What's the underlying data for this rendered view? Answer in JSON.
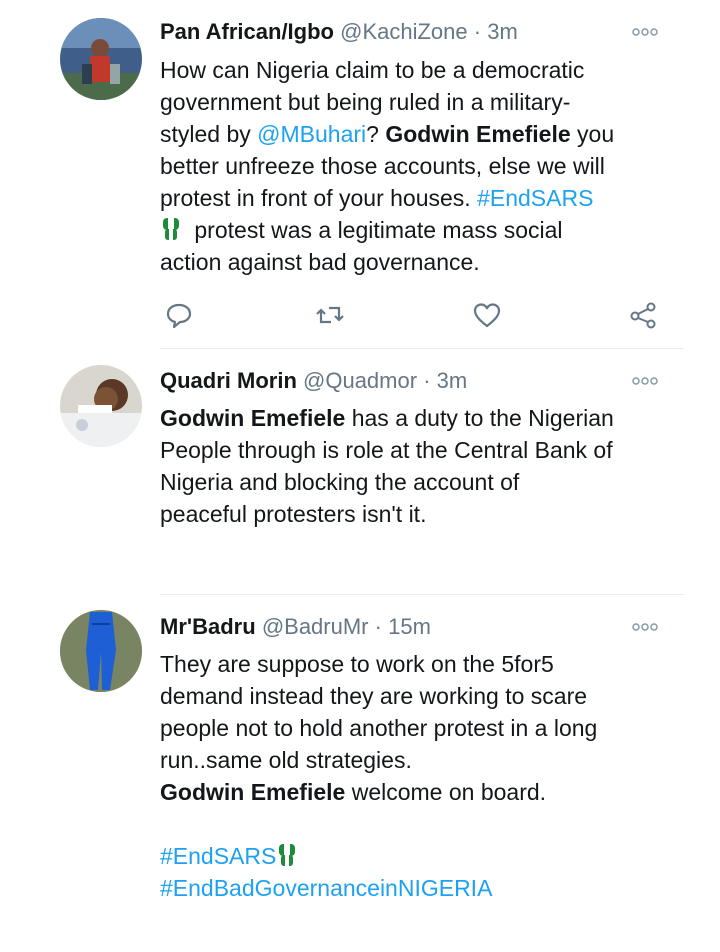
{
  "tweets": [
    {
      "name": "Pan African/Igbo",
      "handle": "@KachiZone",
      "sep": "·",
      "time": "3m",
      "lines": [
        [
          {
            "t": "How can Nigeria claim to be a democratic",
            "s": "n"
          }
        ],
        [
          {
            "t": "government but being ruled in a military-",
            "s": "n"
          }
        ],
        [
          {
            "t": "styled by ",
            "s": "n"
          },
          {
            "t": "@MBuhari",
            "s": "link"
          },
          {
            "t": "? ",
            "s": "n"
          },
          {
            "t": "Godwin Emefiele",
            "s": "b"
          },
          {
            "t": " you",
            "s": "n"
          }
        ],
        [
          {
            "t": "better unfreeze those accounts, else we will",
            "s": "n"
          }
        ],
        [
          {
            "t": "protest in front of your houses. ",
            "s": "n"
          },
          {
            "t": "#EndSARS",
            "s": "link"
          }
        ],
        [
          {
            "t": "[fist]",
            "s": "icon"
          },
          {
            "t": " protest was a legitimate mass social",
            "s": "n"
          }
        ],
        [
          {
            "t": "action against bad governance.",
            "s": "n"
          }
        ]
      ]
    },
    {
      "name": "Quadri Morin",
      "handle": "@Quadmor",
      "sep": "·",
      "time": "3m",
      "lines": [
        [
          {
            "t": "Godwin Emefiele",
            "s": "b"
          },
          {
            "t": " has a duty to the Nigerian",
            "s": "n"
          }
        ],
        [
          {
            "t": "People through is role at the Central Bank of",
            "s": "n"
          }
        ],
        [
          {
            "t": "Nigeria and blocking the account of",
            "s": "n"
          }
        ],
        [
          {
            "t": "peaceful protesters isn't it.",
            "s": "n"
          }
        ]
      ]
    },
    {
      "name": "Mr'Badru",
      "handle": "@BadruMr",
      "sep": "·",
      "time": "15m",
      "lines": [
        [
          {
            "t": "They are suppose to work on the 5for5",
            "s": "n"
          }
        ],
        [
          {
            "t": "demand instead they are working to scare",
            "s": "n"
          }
        ],
        [
          {
            "t": "people not to hold another protest in a long",
            "s": "n"
          }
        ],
        [
          {
            "t": "run..same old strategies.",
            "s": "n"
          }
        ],
        [
          {
            "t": "Godwin Emefiele",
            "s": "b"
          },
          {
            "t": " welcome on board.",
            "s": "n"
          }
        ],
        [
          {
            "t": "",
            "s": "n"
          }
        ],
        [
          {
            "t": "#EndSARS",
            "s": "link"
          },
          {
            "t": "[fist]",
            "s": "icon"
          }
        ],
        [
          {
            "t": "#EndBadGovernanceinNIGERIA",
            "s": "link"
          }
        ]
      ]
    }
  ],
  "icons": {
    "reply": "reply-icon",
    "retweet": "retweet-icon",
    "like": "heart-icon",
    "share": "share-icon",
    "more": "more-icon",
    "fist": "raised-fist-icon"
  },
  "colors": {
    "link": "#1da1f2",
    "meta": "#657786",
    "icon": "#657786",
    "fist": "#1e8a3c"
  }
}
